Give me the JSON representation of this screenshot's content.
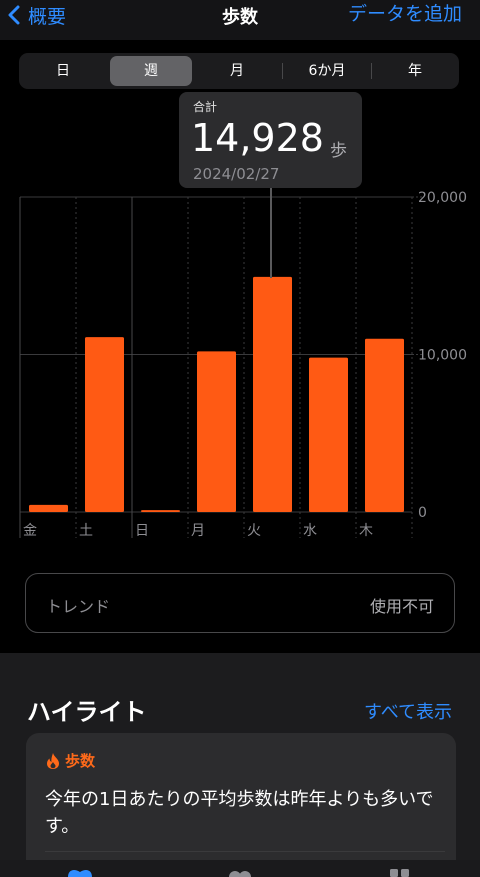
{
  "nav": {
    "back_label": "概要",
    "title": "歩数",
    "add_label": "データを追加"
  },
  "segments": [
    "日",
    "週",
    "月",
    "6か月",
    "年"
  ],
  "selected_segment": "週",
  "tooltip": {
    "label": "合計",
    "value": "14,928",
    "unit": "歩",
    "date": "2024/02/27"
  },
  "chart_data": {
    "type": "bar",
    "categories": [
      "金",
      "土",
      "日",
      "月",
      "火",
      "水",
      "木"
    ],
    "values": [
      450,
      11100,
      120,
      10200,
      14928,
      9800,
      11000
    ],
    "highlighted_index": 4,
    "yticks": [
      "0",
      "10,000",
      "20,000"
    ],
    "ytick_values": [
      0,
      10000,
      20000
    ],
    "ylim": [
      0,
      20000
    ],
    "colors": {
      "bar": "#ff5a14",
      "grid": "#3a3a3c",
      "label": "#8e8e93"
    }
  },
  "trend": {
    "label": "トレンド",
    "status": "使用不可"
  },
  "highlights": {
    "title": "ハイライト",
    "show_all": "すべて表示",
    "card": {
      "category": "歩数",
      "text": "今年の1日あたりの平均歩数は昨年よりも多いです。"
    }
  },
  "colors": {
    "accent": "#2f8cff",
    "steps": "#ff5a14",
    "background": "#000000"
  }
}
